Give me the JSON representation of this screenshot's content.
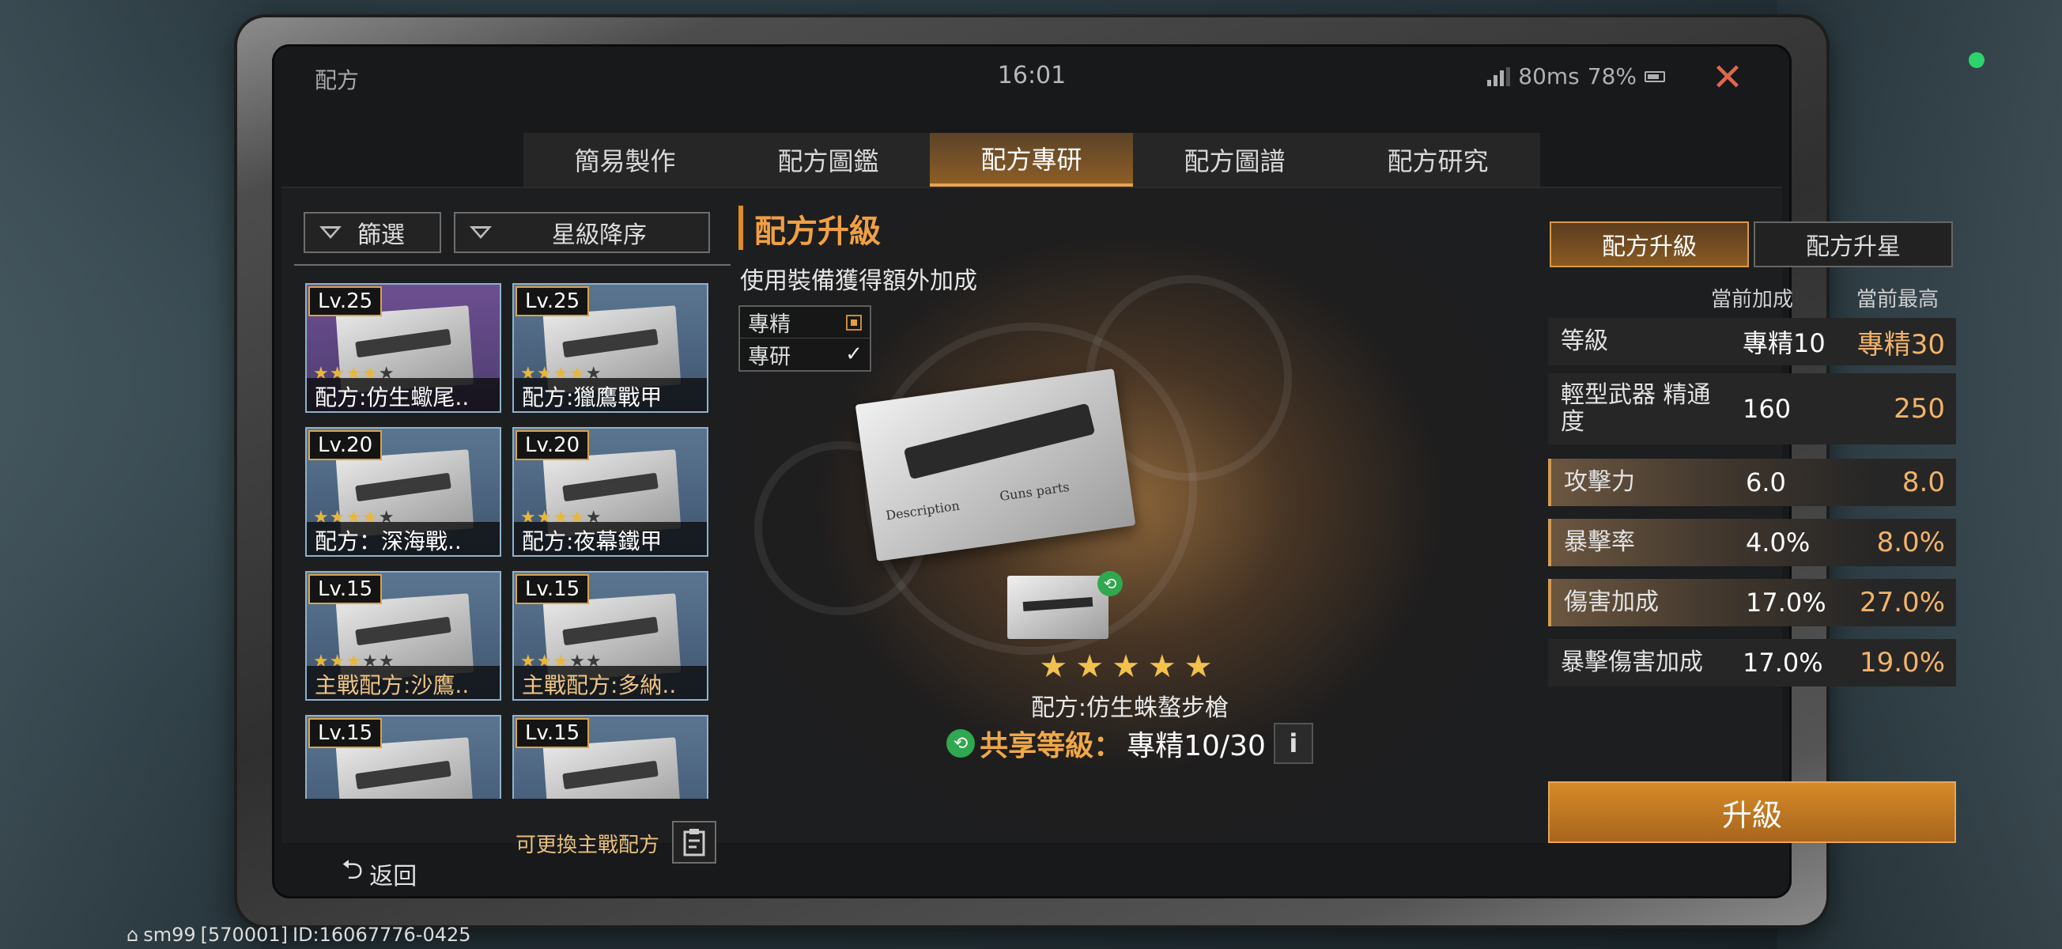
{
  "topbar": {
    "title": "配方",
    "clock": "16:01",
    "ping": "80ms",
    "battery": "78%",
    "close_icon": "close-icon"
  },
  "tabs": [
    {
      "label": "簡易製作",
      "active": false
    },
    {
      "label": "配方圖鑑",
      "active": false
    },
    {
      "label": "配方專研",
      "active": true
    },
    {
      "label": "配方圖譜",
      "active": false
    },
    {
      "label": "配方研究",
      "active": false
    }
  ],
  "filter": {
    "filter_label": "篩選",
    "sort_label": "星級降序"
  },
  "cards": [
    {
      "level": "Lv.25",
      "stars_filled": 4,
      "stars_total": 5,
      "name": "配方:仿生蠍尾..",
      "rarity": "purple"
    },
    {
      "level": "Lv.25",
      "stars_filled": 4,
      "stars_total": 5,
      "name": "配方:獵鷹戰甲",
      "rarity": "blue"
    },
    {
      "level": "Lv.20",
      "stars_filled": 4,
      "stars_total": 5,
      "name": "配方：深海戰..",
      "rarity": "blue"
    },
    {
      "level": "Lv.20",
      "stars_filled": 4,
      "stars_total": 5,
      "name": "配方:夜幕鐵甲",
      "rarity": "blue"
    },
    {
      "level": "Lv.15",
      "stars_filled": 3,
      "stars_total": 5,
      "name": "主戰配方:沙鷹..",
      "rarity": "blue",
      "primary": true
    },
    {
      "level": "Lv.15",
      "stars_filled": 3,
      "stars_total": 5,
      "name": "主戰配方:多納..",
      "rarity": "blue",
      "primary": true
    },
    {
      "level": "Lv.15",
      "stars_filled": 0,
      "stars_total": 5,
      "name": "",
      "rarity": "blue"
    },
    {
      "level": "Lv.15",
      "stars_filled": 0,
      "stars_total": 5,
      "name": "",
      "rarity": "blue"
    }
  ],
  "swap": {
    "label": "可更換主戰配方"
  },
  "center": {
    "title": "配方升級",
    "subtitle": "使用裝備獲得額外加成",
    "checks": [
      {
        "label": "專精",
        "state": "dot"
      },
      {
        "label": "專研",
        "state": "tick"
      }
    ],
    "paper_words": {
      "description": "Description",
      "parts": "Guns parts"
    },
    "stars": "★★★★★",
    "item_name": "配方:仿生蛛螯步槍",
    "share_label": "共享等級：",
    "share_value": "專精10/30",
    "info_label": "i"
  },
  "right": {
    "tabs": [
      {
        "label": "配方升級",
        "active": true
      },
      {
        "label": "配方升星",
        "active": false
      }
    ],
    "col_current": "當前加成",
    "col_max": "當前最高",
    "stats": [
      {
        "key": "等級",
        "current": "專精10",
        "max": "專精30",
        "highlight": false
      },
      {
        "key": "輕型武器 精通度",
        "current": "160",
        "max": "250",
        "highlight": false
      },
      {
        "key": "攻擊力",
        "current": "6.0",
        "max": "8.0",
        "highlight": true
      },
      {
        "key": "暴擊率",
        "current": "4.0%",
        "max": "8.0%",
        "highlight": true
      },
      {
        "key": "傷害加成",
        "current": "17.0%",
        "max": "27.0%",
        "highlight": true
      },
      {
        "key": "暴擊傷害加成",
        "current": "17.0%",
        "max": "19.0%",
        "highlight": false
      }
    ],
    "upgrade_label": "升級"
  },
  "back": {
    "label": "返回"
  },
  "footer": {
    "user": "sm99",
    "server": "[570001]",
    "id": "ID:16067776-0425"
  }
}
